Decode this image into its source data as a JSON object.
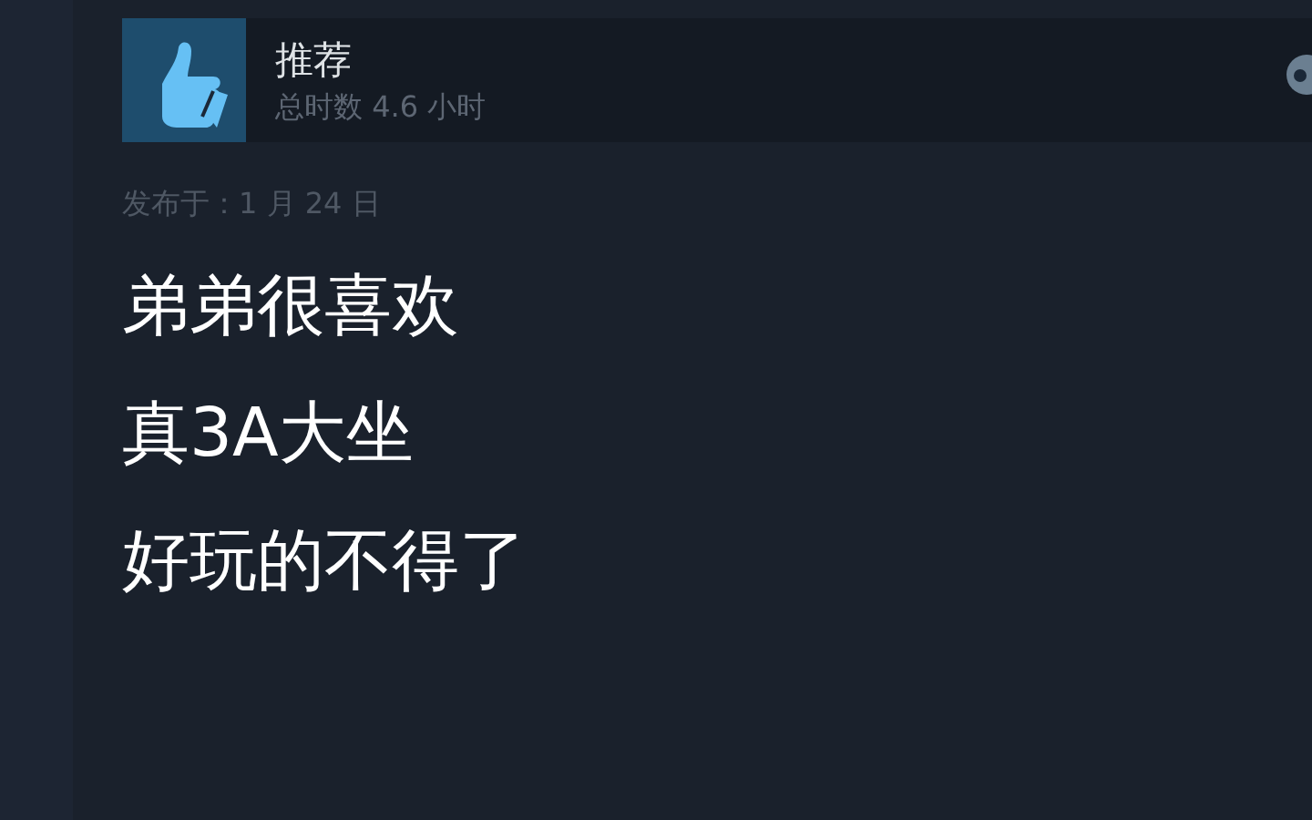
{
  "review": {
    "verdict": "推荐",
    "playtime": "总时数 4.6 小时",
    "posted": "发布于：1 月 24 日",
    "lines": [
      "弟弟很喜欢",
      "真3A大坐",
      "好玩的不得了"
    ]
  }
}
